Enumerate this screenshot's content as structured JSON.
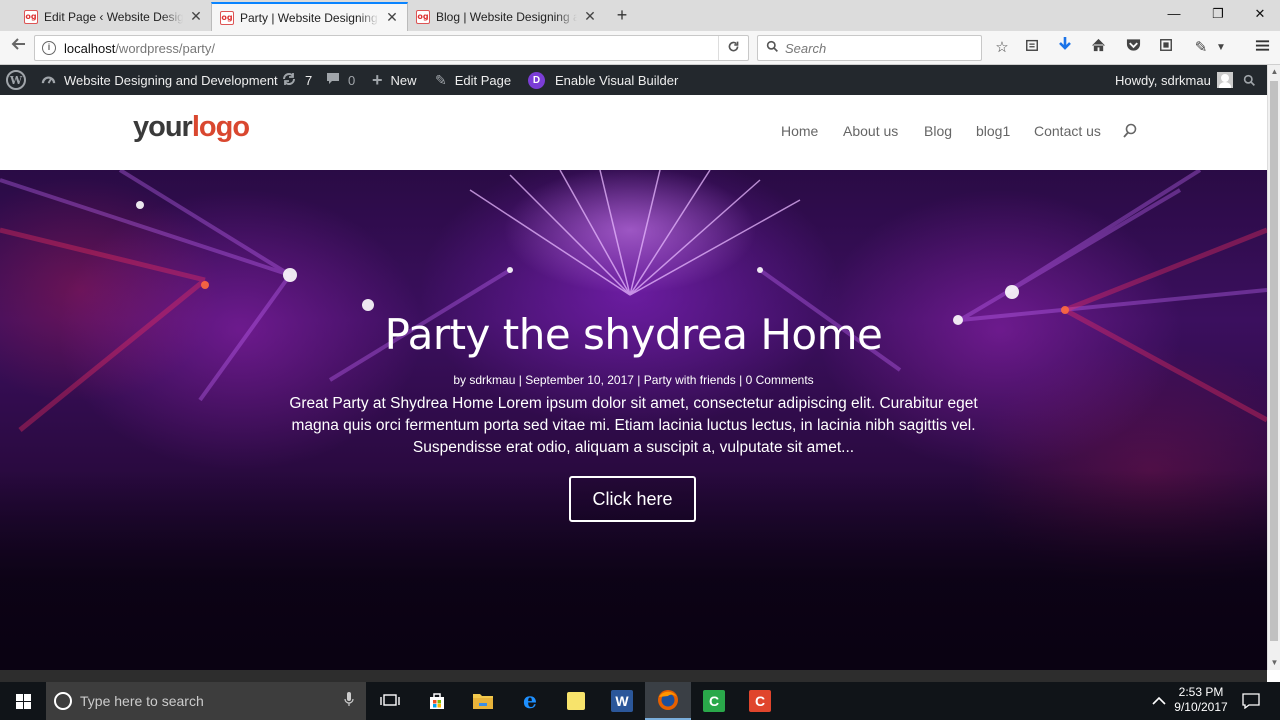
{
  "browser": {
    "tabs": [
      {
        "title": "Edit Page ‹ Website Designin",
        "favicon": "og",
        "active": false
      },
      {
        "title": "Party | Website Designing ar",
        "favicon": "og",
        "active": true
      },
      {
        "title": "Blog | Website Designing ar",
        "favicon": "og",
        "active": false
      }
    ],
    "new_tab_label": "+",
    "window_controls": {
      "minimize": "—",
      "maximize": "❐",
      "close": "✕"
    },
    "url_host": "localhost",
    "url_path": "/wordpress/party/",
    "search_placeholder": "Search"
  },
  "admin_bar": {
    "site_name": "Website Designing and Development",
    "updates_count": "7",
    "comments_count": "0",
    "new_label": "New",
    "edit_label": "Edit Page",
    "visual_builder_label": "Enable Visual Builder",
    "greeting": "Howdy, sdrkmau"
  },
  "site": {
    "logo_part1": "your",
    "logo_part2": "logo",
    "menu": [
      "Home",
      "About us",
      "Blog",
      "blog1",
      "Contact us"
    ]
  },
  "hero": {
    "title": "Party the shydrea Home",
    "meta_by": "by",
    "meta_author": "sdrkmau",
    "meta_date": "September 10, 2017",
    "meta_category": "Party with friends",
    "meta_comments": "0 Comments",
    "meta_sep": "|",
    "description": "Great Party at Shydrea Home Lorem ipsum dolor sit amet, consectetur adipiscing elit. Curabitur eget magna quis orci fermentum porta sed vitae mi. Etiam lacinia luctus lectus, in lacinia nibh sagittis vel. Suspendisse erat odio, aliquam a suscipit a, vulputate sit amet...",
    "button_label": "Click here"
  },
  "taskbar": {
    "search_placeholder": "Type here to search",
    "time": "2:53 PM",
    "date": "9/10/2017"
  },
  "colors": {
    "accent_tab": "#0a84ff",
    "logo_red": "#d9472f",
    "admin_bar": "#23282d",
    "divi_purple": "#7b3dd6"
  }
}
